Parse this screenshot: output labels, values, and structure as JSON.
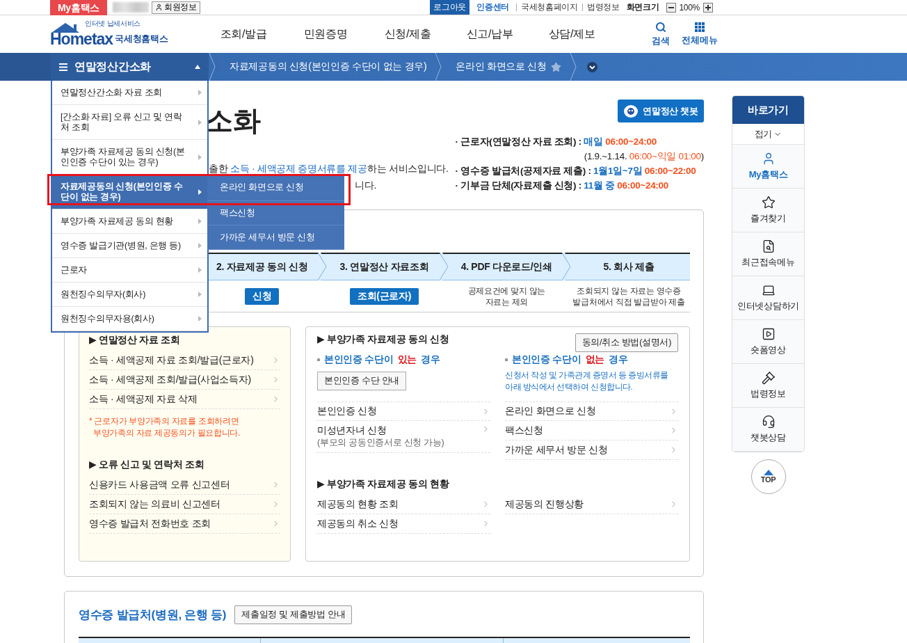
{
  "topbar": {
    "my_tab": "My홈택스",
    "member_button": "회원정보",
    "logout": "로그아웃",
    "auth_center": "인증센터",
    "links": [
      "국세청홈페이지",
      "법령정보"
    ],
    "zoom_label": "화면크기",
    "zoom_value": "100%"
  },
  "header": {
    "logo": {
      "tagline": "인터넷 납세서비스",
      "wordmark": "Hometax",
      "name": "국세청홈택스"
    },
    "nav": [
      "조회/발급",
      "민원증명",
      "신청/제출",
      "신고/납부",
      "상담/제보"
    ],
    "search": "검색",
    "all_menu": "전체메뉴"
  },
  "breadcrumb": {
    "menu_title": "연말정산간소화",
    "menu_open": true,
    "crumbs": [
      {
        "label": "자료제공동의 신청(본인인증 수단이 없는 경우)"
      },
      {
        "label": "온라인 화면으로 신청",
        "favorite": false
      }
    ]
  },
  "dropdown": {
    "items": [
      {
        "label": "연말정산간소화 자료 조회",
        "selected": false
      },
      {
        "label": "[간소화 자료] 오류 신고 및 연락처 조회",
        "selected": false
      },
      {
        "label": "부양가족 자료제공 동의 신청(본인인증 수단이 있는 경우)",
        "selected": false
      },
      {
        "label": "자료제공동의 신청(본인인증 수단이 없는 경우)",
        "selected": true,
        "children": [
          {
            "label": "온라인 화면으로 신청"
          },
          {
            "label": "팩스신청"
          },
          {
            "label": "가까운 세무서 방문 신청"
          }
        ]
      },
      {
        "label": "부양가족 자료제공 동의 현황",
        "selected": false
      },
      {
        "label": "영수증 발급기관(병원, 은행 등)",
        "selected": false
      },
      {
        "label": "근로자",
        "selected": false
      },
      {
        "label": "원천징수의무자(회사)",
        "selected": false
      },
      {
        "label": "원천징수의무자용(회사)",
        "selected": false
      }
    ]
  },
  "intro": {
    "title": "소화",
    "description": [
      {
        "kind": "plain",
        "text": "출한 "
      },
      {
        "kind": "link",
        "text": "소득 · 세액공제 증명서류를 제공"
      },
      {
        "kind": "plain",
        "text": "하는 서비스입니다."
      }
    ],
    "description_end": "니다.",
    "chatbot_button": "연말정산 챗봇",
    "schedule": [
      {
        "kind": "main",
        "segments": [
          {
            "kind": "label",
            "text": "· 근로자(연말정산 자료 조회) : "
          },
          {
            "kind": "date",
            "text": "매일 "
          },
          {
            "kind": "time",
            "text": "06:00~24:00"
          }
        ]
      },
      {
        "kind": "sub",
        "segments": [
          {
            "kind": "plain",
            "text": "(1.9.~1.14. "
          },
          {
            "kind": "time",
            "text": "06:00~익일 01:00"
          },
          {
            "kind": "plain",
            "text": ")"
          }
        ]
      },
      {
        "kind": "main",
        "segments": [
          {
            "kind": "label",
            "text": "· 영수증 발급처(공제자료 제출) : "
          },
          {
            "kind": "date",
            "text": "1월1일~7일 "
          },
          {
            "kind": "time",
            "text": "06:00~22:00"
          }
        ]
      },
      {
        "kind": "main",
        "segments": [
          {
            "kind": "label",
            "text": "· 기부금 단체(자료제출 신청) : "
          },
          {
            "kind": "date",
            "text": "11월 중 "
          },
          {
            "kind": "time",
            "text": "06:00~24:00"
          }
        ]
      }
    ]
  },
  "steps": [
    {
      "label": "2. 자료제공 동의 신청",
      "action": {
        "kind": "button",
        "text": "신청"
      }
    },
    {
      "label": "3. 연말정산 자료조회",
      "action": {
        "kind": "button",
        "text": "조회(근로자)"
      }
    },
    {
      "label": "4. PDF 다운로드/인쇄",
      "action": {
        "kind": "note",
        "lines": [
          "공제요건에 맞지 않는",
          "자료는 제외"
        ]
      }
    },
    {
      "label": "5. 회사 제출",
      "action": {
        "kind": "note",
        "lines": [
          "조회되지 않는 자료는 영수증",
          "발급처에서 직접 발급받아 제출"
        ]
      }
    }
  ],
  "left_panel": {
    "sections": [
      {
        "heading": "▶ 연말정산 자료 조회",
        "links": [
          "소득 · 세액공제 자료 조회/발급(근로자)",
          "소득 · 세액공제 조회/발급(사업소득자)",
          "소득 · 세액공제 자료 삭제"
        ],
        "note": [
          "* 근로자가 부양가족의 자료를 조회하려면",
          "부양가족의 자료 제공동의가 필요합니다."
        ]
      },
      {
        "heading": "▶ 오류 신고 및 연락처 조회",
        "links": [
          "신용카드 사용금액 오류 신고센터",
          "조회되지 않는 의료비 신고센터",
          "영수증 발급처 전화번호 조회"
        ]
      }
    ]
  },
  "right_panel": {
    "heading": "▶ 부양가족 자료제공 동의 신청",
    "guide_button": "동의/취소 방법(설명서)",
    "columns": [
      {
        "subheading": [
          {
            "kind": "plain",
            "text": "본인인증 수단이 "
          },
          {
            "kind": "emphasis",
            "text": "있는"
          },
          {
            "kind": "plain",
            "text": " 경우"
          }
        ],
        "button": "본인인증 수단 안내",
        "links": [
          {
            "label": "본인인증 신청"
          },
          {
            "label": "미성년자녀 신청",
            "sub": "(부모의 공동인증서로 신청 가능)"
          }
        ]
      },
      {
        "subheading": [
          {
            "kind": "plain",
            "text": "본인인증 수단이 "
          },
          {
            "kind": "emphasis",
            "text": "없는"
          },
          {
            "kind": "plain",
            "text": " 경우"
          }
        ],
        "description": [
          "신청서 작성 및 가족관계 증명서 등 증빙서류를",
          "아래 방식에서 선택하여 신청합니다."
        ],
        "links": [
          {
            "label": "온라인 화면으로 신청"
          },
          {
            "label": "팩스신청"
          },
          {
            "label": "가까운 세무서 방문 신청"
          }
        ]
      }
    ],
    "status_heading": "▶ 부양가족 자료제공 동의 현황",
    "status_columns": [
      [
        "제공동의 현황 조회",
        "제공동의 취소 신청"
      ],
      [
        "제공동의 진행상황"
      ]
    ]
  },
  "receipt_section": {
    "title": "영수증 발급처(병원, 은행 등)",
    "button": "제출일정 및 제출방법 안내"
  },
  "sidebar": {
    "title": "바로가기",
    "collapse": "접기",
    "items": [
      {
        "kind": "person",
        "label": "My홈택스",
        "highlighted": true
      },
      {
        "kind": "star",
        "label": "즐겨찾기",
        "highlighted": false
      },
      {
        "kind": "recent",
        "label": "최근접속메뉴",
        "highlighted": false
      },
      {
        "kind": "laptop",
        "label": "인터넷상담하기",
        "highlighted": false
      },
      {
        "kind": "video",
        "label": "숏폼영상",
        "highlighted": false
      },
      {
        "kind": "law",
        "label": "법령정보",
        "highlighted": false
      },
      {
        "kind": "chatbot",
        "label": "챗봇상담",
        "highlighted": false
      }
    ],
    "top_button": "TOP"
  }
}
